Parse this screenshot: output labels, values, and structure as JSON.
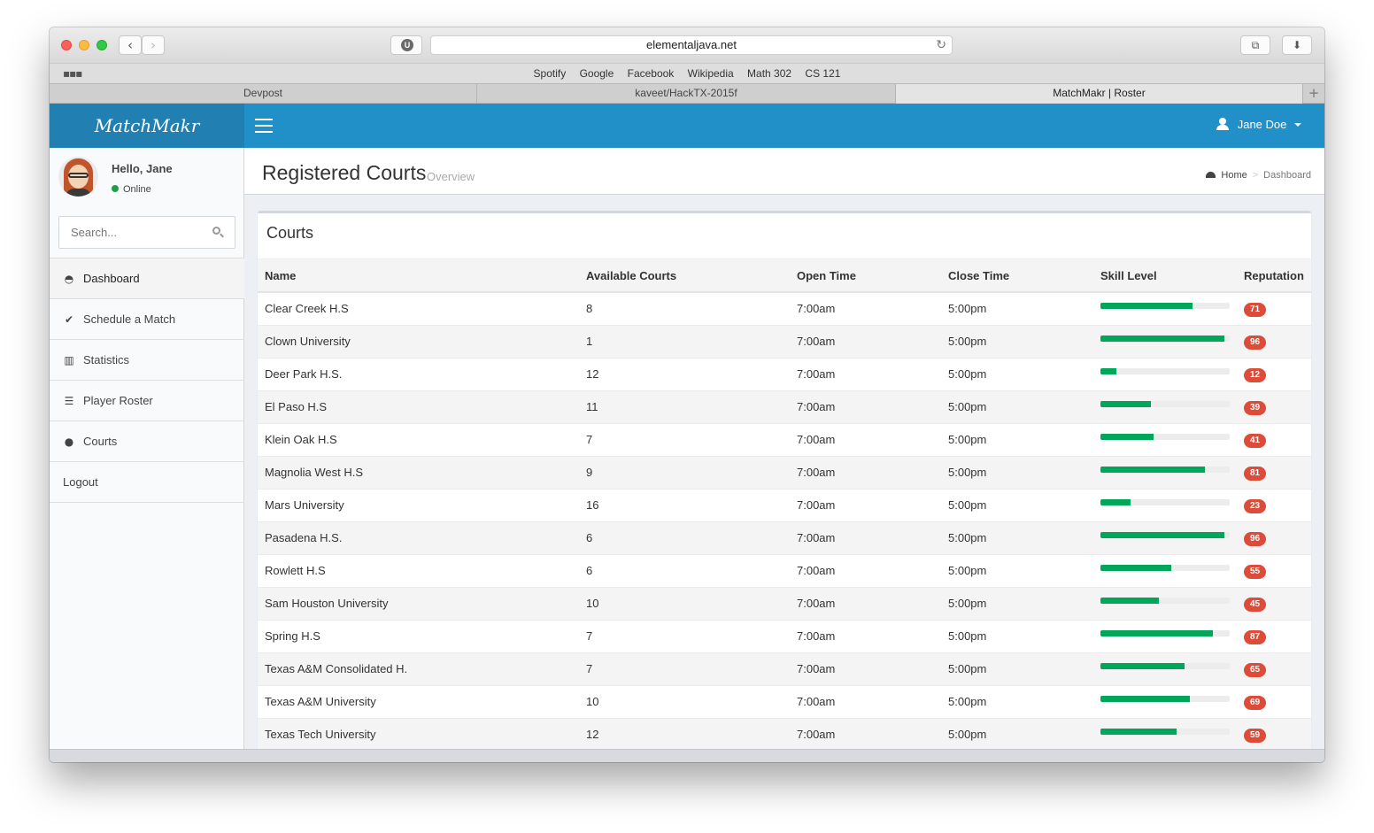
{
  "browser": {
    "url": "elementaljava.net",
    "bookmarks": [
      "Spotify",
      "Google",
      "Facebook",
      "Wikipedia",
      "Math 302",
      "CS 121"
    ],
    "tabs": [
      "Devpost",
      "kaveet/HackTX-2015f",
      "MatchMakr | Roster"
    ]
  },
  "app": {
    "logo": "MatchMakr",
    "user_name": "Jane Doe"
  },
  "sidebar": {
    "greeting": "Hello, Jane",
    "status": "Online",
    "search_placeholder": "Search...",
    "items": [
      {
        "label": "Dashboard",
        "icon": "dashboard-icon"
      },
      {
        "label": "Schedule a Match",
        "icon": "check-icon"
      },
      {
        "label": "Statistics",
        "icon": "bar-chart-icon"
      },
      {
        "label": "Player Roster",
        "icon": "list-icon"
      },
      {
        "label": "Courts",
        "icon": "map-marker-icon"
      },
      {
        "label": "Logout",
        "icon": ""
      }
    ]
  },
  "page": {
    "title": "Registered Courts",
    "subtitle": "Overview",
    "breadcrumb": [
      "Home",
      "Dashboard"
    ]
  },
  "box": {
    "title": "Courts",
    "columns": [
      "Name",
      "Available Courts",
      "Open Time",
      "Close Time",
      "Skill Level",
      "Reputation"
    ],
    "rows": [
      {
        "name": "Clear Creek H.S",
        "courts": "8",
        "open": "7:00am",
        "close": "5:00pm",
        "skill": 0.71,
        "reputation": "71"
      },
      {
        "name": "Clown University",
        "courts": "1",
        "open": "7:00am",
        "close": "5:00pm",
        "skill": 0.96,
        "reputation": "96"
      },
      {
        "name": "Deer Park H.S.",
        "courts": "12",
        "open": "7:00am",
        "close": "5:00pm",
        "skill": 0.12,
        "reputation": "12"
      },
      {
        "name": "El Paso H.S",
        "courts": "11",
        "open": "7:00am",
        "close": "5:00pm",
        "skill": 0.39,
        "reputation": "39"
      },
      {
        "name": "Klein Oak H.S",
        "courts": "7",
        "open": "7:00am",
        "close": "5:00pm",
        "skill": 0.41,
        "reputation": "41"
      },
      {
        "name": "Magnolia West H.S",
        "courts": "9",
        "open": "7:00am",
        "close": "5:00pm",
        "skill": 0.81,
        "reputation": "81"
      },
      {
        "name": "Mars University",
        "courts": "16",
        "open": "7:00am",
        "close": "5:00pm",
        "skill": 0.23,
        "reputation": "23"
      },
      {
        "name": "Pasadena H.S.",
        "courts": "6",
        "open": "7:00am",
        "close": "5:00pm",
        "skill": 0.96,
        "reputation": "96"
      },
      {
        "name": "Rowlett H.S",
        "courts": "6",
        "open": "7:00am",
        "close": "5:00pm",
        "skill": 0.55,
        "reputation": "55"
      },
      {
        "name": "Sam Houston University",
        "courts": "10",
        "open": "7:00am",
        "close": "5:00pm",
        "skill": 0.45,
        "reputation": "45"
      },
      {
        "name": "Spring H.S",
        "courts": "7",
        "open": "7:00am",
        "close": "5:00pm",
        "skill": 0.87,
        "reputation": "87"
      },
      {
        "name": "Texas A&M Consolidated H.",
        "courts": "7",
        "open": "7:00am",
        "close": "5:00pm",
        "skill": 0.65,
        "reputation": "65"
      },
      {
        "name": "Texas A&M University",
        "courts": "10",
        "open": "7:00am",
        "close": "5:00pm",
        "skill": 0.69,
        "reputation": "69"
      },
      {
        "name": "Texas Tech University",
        "courts": "12",
        "open": "7:00am",
        "close": "5:00pm",
        "skill": 0.59,
        "reputation": "59"
      }
    ]
  },
  "colors": {
    "header": "#2290c8",
    "logo_bg": "#217fb1",
    "progress": "#00a65a",
    "badge": "#dd4b39",
    "online": "#1f9d47"
  }
}
